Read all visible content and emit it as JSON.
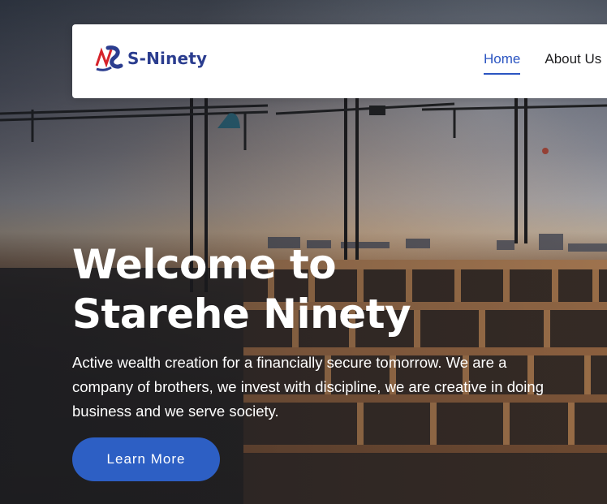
{
  "brand": {
    "logo_text": "S-Ninety",
    "logo_color": "#2b3d8f",
    "logo_accent": "#d6232a",
    "logo_icon": "s-ninety-logo-mark"
  },
  "nav": {
    "items": [
      {
        "label": "Home",
        "active": true
      },
      {
        "label": "About Us",
        "active": false
      }
    ],
    "active_color": "#2b55c2"
  },
  "hero": {
    "title_line1": "Welcome to",
    "title_line2": "Starehe Ninety",
    "description": "Active wealth creation for a financially secure tomorrow. We are a company of brothers, we invest with discipline, we are creative in doing business and we serve society.",
    "cta_label": "Learn More",
    "cta_color": "#2d5fc4",
    "background": "construction-site-cranes-sunset-photo"
  }
}
